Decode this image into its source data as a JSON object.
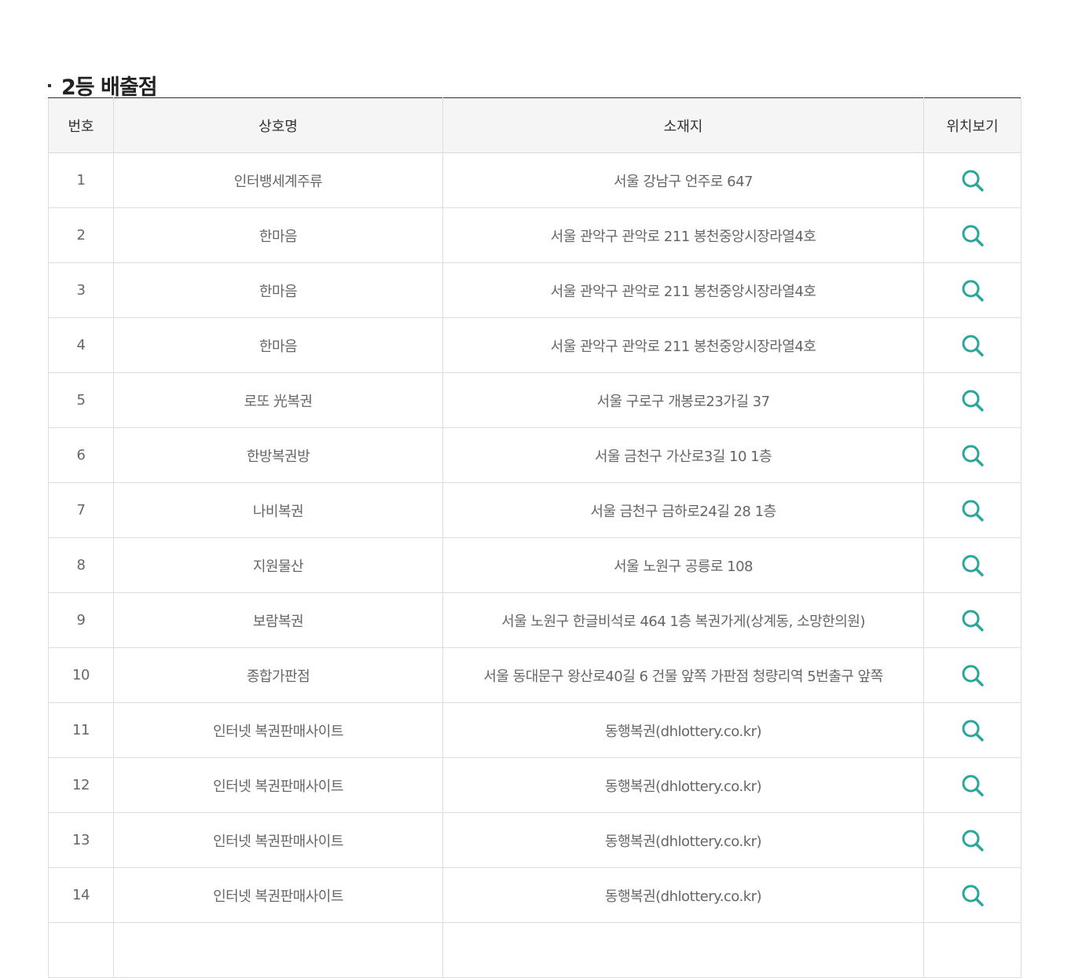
{
  "section": {
    "title": "2등 배출점"
  },
  "table": {
    "headers": {
      "num": "번호",
      "name": "상호명",
      "address": "소재지",
      "location": "위치보기"
    },
    "rows": [
      {
        "num": "1",
        "name": "인터뱅세계주류",
        "address": "서울 강남구 언주로 647"
      },
      {
        "num": "2",
        "name": "한마음",
        "address": "서울 관악구 관악로 211 봉천중앙시장라열4호"
      },
      {
        "num": "3",
        "name": "한마음",
        "address": "서울 관악구 관악로 211 봉천중앙시장라열4호"
      },
      {
        "num": "4",
        "name": "한마음",
        "address": "서울 관악구 관악로 211 봉천중앙시장라열4호"
      },
      {
        "num": "5",
        "name": "로또 光복권",
        "address": "서울 구로구 개봉로23가길 37"
      },
      {
        "num": "6",
        "name": "한방복권방",
        "address": "서울 금천구 가산로3길 10 1층"
      },
      {
        "num": "7",
        "name": "나비복권",
        "address": "서울 금천구 금하로24길 28 1층"
      },
      {
        "num": "8",
        "name": "지원물산",
        "address": "서울 노원구 공릉로 108"
      },
      {
        "num": "9",
        "name": "보람복권",
        "address": "서울 노원구 한글비석로 464 1층 복권가게(상계동, 소망한의원)"
      },
      {
        "num": "10",
        "name": "종합가판점",
        "address": "서울 동대문구 왕산로40길 6 건물 앞쪽 가판점 청량리역 5번출구 앞쪽"
      },
      {
        "num": "11",
        "name": "인터넷 복권판매사이트",
        "address": "동행복권(dhlottery.co.kr)"
      },
      {
        "num": "12",
        "name": "인터넷 복권판매사이트",
        "address": "동행복권(dhlottery.co.kr)"
      },
      {
        "num": "13",
        "name": "인터넷 복권판매사이트",
        "address": "동행복권(dhlottery.co.kr)"
      },
      {
        "num": "14",
        "name": "인터넷 복권판매사이트",
        "address": "동행복권(dhlottery.co.kr)"
      },
      {
        "num": "",
        "name": "",
        "address": ""
      }
    ]
  },
  "icons": {
    "location": "search-icon"
  },
  "colors": {
    "icon": "#2aa79b",
    "header_bg": "#f5f5f5",
    "border": "#dddddd",
    "top_border": "#333333"
  }
}
